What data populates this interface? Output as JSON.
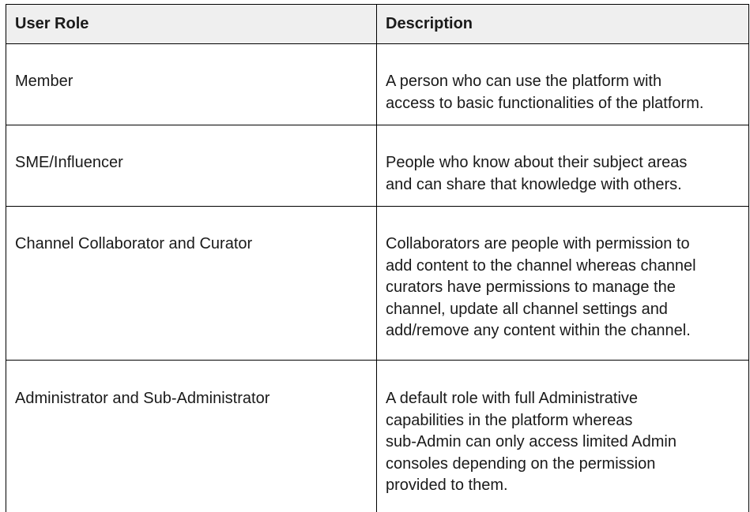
{
  "table": {
    "headers": {
      "role": "User Role",
      "description": "Description"
    },
    "rows": [
      {
        "role": "Member",
        "description_lines": [
          "A person who can use the platform with",
          "access to basic functionalities of the platform."
        ]
      },
      {
        "role": "SME/Influencer",
        "description_lines": [
          "People who know about their subject areas",
          "and can share that knowledge with others."
        ]
      },
      {
        "role": "Channel Collaborator and Curator",
        "description_lines": [
          "Collaborators are people with permission to",
          "add content to the channel whereas channel",
          "curators have permissions to manage the",
          "channel, update all channel settings and",
          "add/remove any content within the channel."
        ]
      },
      {
        "role": "Administrator and Sub-Administrator",
        "description_lines": [
          "A default role with full Administrative",
          "capabilities in the platform whereas",
          "sub-Admin can only access limited Admin",
          "consoles depending on the permission",
          "provided to them."
        ]
      }
    ]
  }
}
